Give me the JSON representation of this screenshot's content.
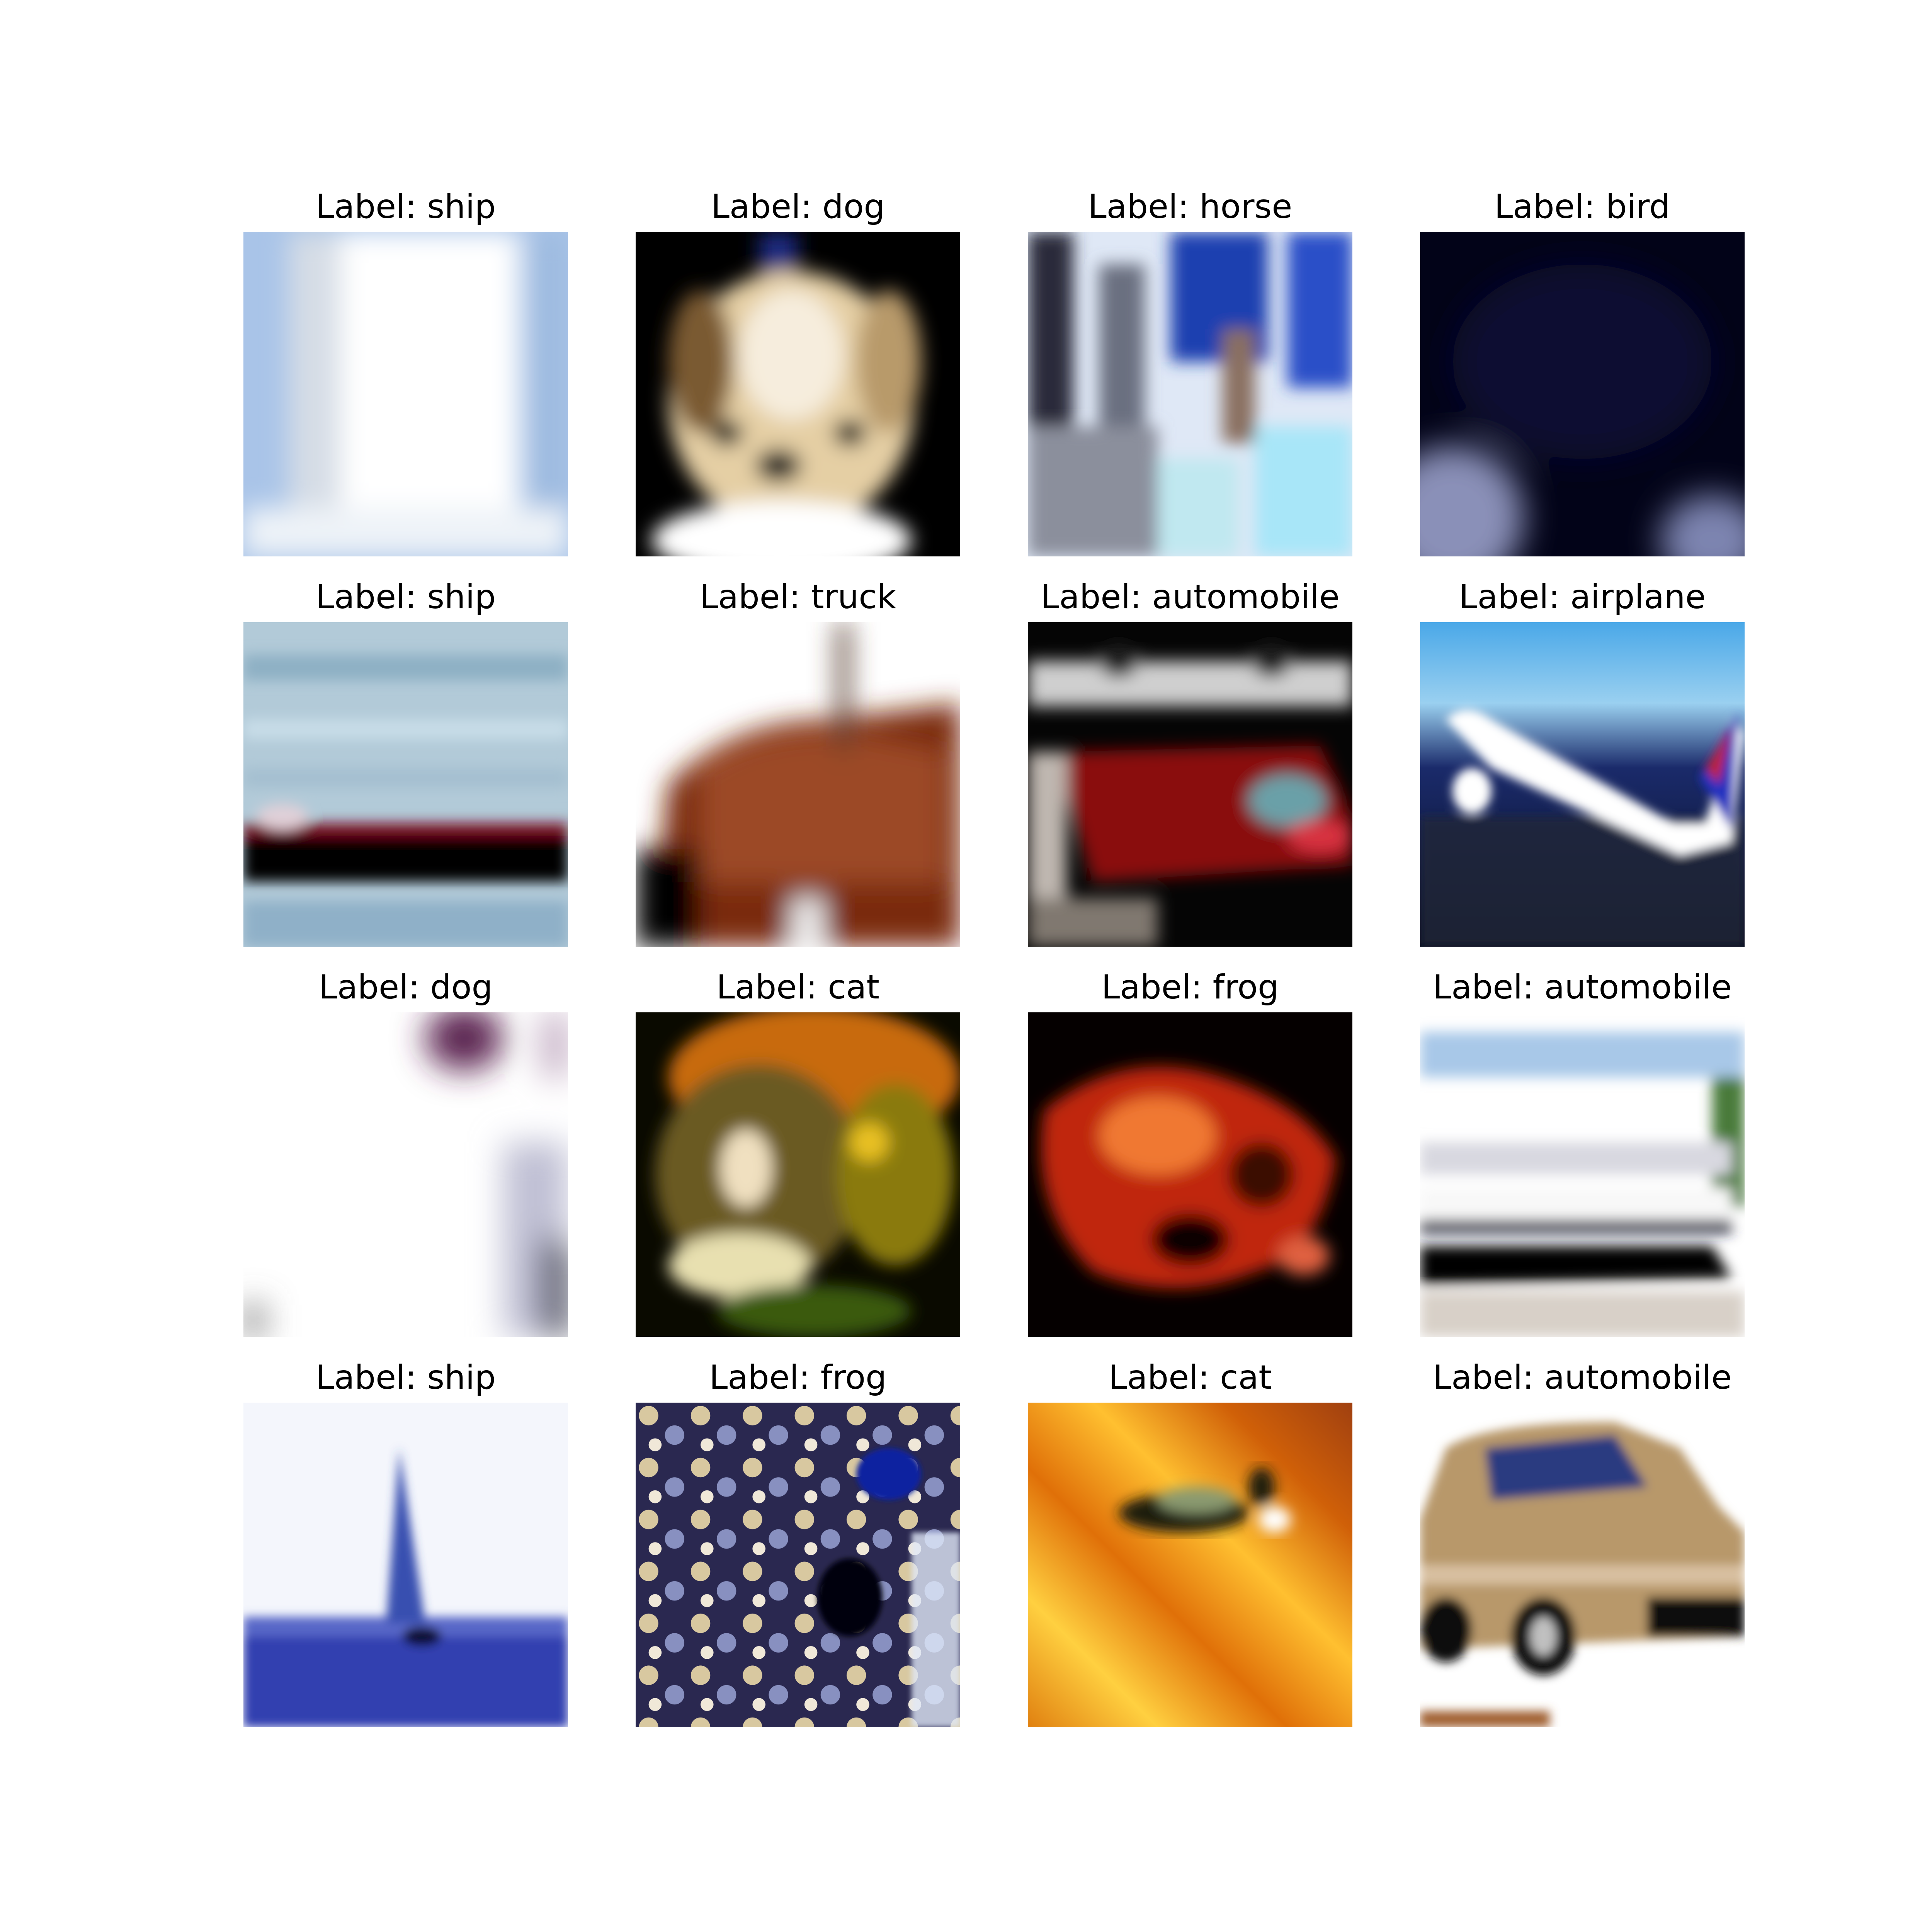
{
  "figure": {
    "panels": [
      {
        "label": "Label: ship",
        "depicts": "pale blurry white-blue sky with sail"
      },
      {
        "label": "Label: dog",
        "depicts": "tan and white small dog face on black background"
      },
      {
        "label": "Label: horse",
        "depicts": "high-contrast blurry blue and white scene"
      },
      {
        "label": "Label: bird",
        "depicts": "dark navy background with pale shapes at bottom"
      },
      {
        "label": "Label: ship",
        "depicts": "dark red hull ship on grey-blue water"
      },
      {
        "label": "Label: truck",
        "depicts": "brown blurry vehicle on white background"
      },
      {
        "label": "Label: automobile",
        "depicts": "red car in dark scene"
      },
      {
        "label": "Label: airplane",
        "depicts": "white airplane against blue sky and dark ground"
      },
      {
        "label": "Label: dog",
        "depicts": "mostly white blurry image with purple corner"
      },
      {
        "label": "Label: cat",
        "depicts": "tabby cat face on dark yellow background"
      },
      {
        "label": "Label: frog",
        "depicts": "orange-red frog on black background"
      },
      {
        "label": "Label: automobile",
        "depicts": "white car with dark shadow"
      },
      {
        "label": "Label: ship",
        "depicts": "blue sailboat on water under white sky"
      },
      {
        "label": "Label: frog",
        "depicts": "camouflaged mottled dark blue and white texture"
      },
      {
        "label": "Label: cat",
        "depicts": "dark cat lying on orange-yellow striped surface"
      },
      {
        "label": "Label: automobile",
        "depicts": "tan SUV on white background"
      }
    ]
  }
}
